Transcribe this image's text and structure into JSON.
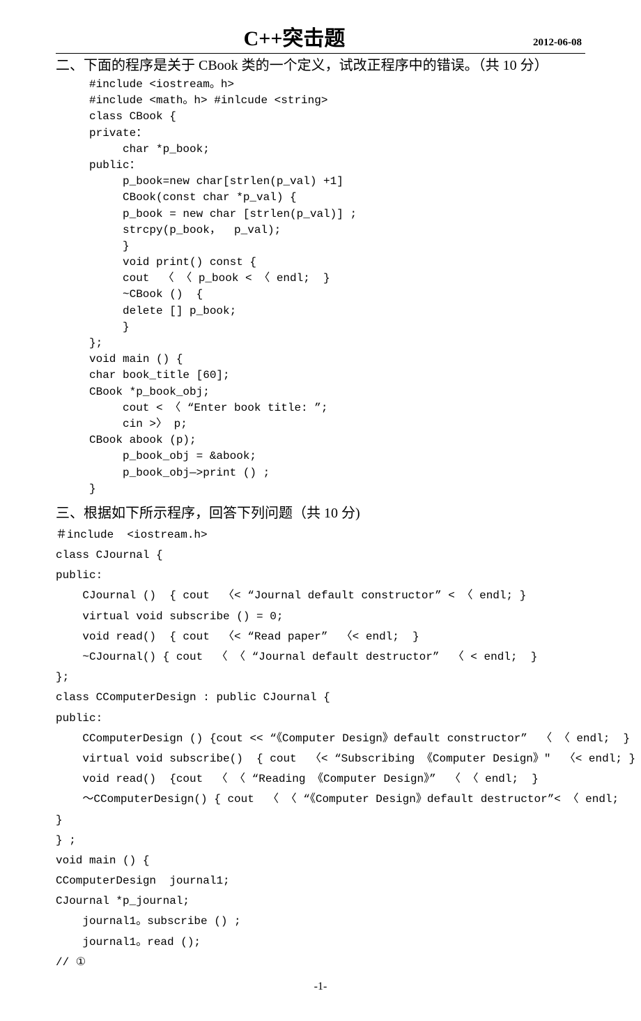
{
  "header": {
    "title": "C++突击题",
    "date": "2012-06-08"
  },
  "section2": {
    "heading": "二、下面的程序是关于 CBook 类的一个定义，试改正程序中的错误。（共 10 分）",
    "lines": {
      "l01": "#include <iostream。h>",
      "l02": "#include <math。h> #inlcude <string>",
      "l03": "class CBook {",
      "l04": "private：",
      "l05": "char *p_book;",
      "l06": "public：",
      "l07": "p_book=new char[strlen(p_val) +1]",
      "l08": "CBook(const char *p_val) {",
      "l09": "p_book = new char [strlen(p_val)] ;",
      "l10": "strcpy(p_book，  p_val);",
      "l11": "}",
      "l12": "void print() const {",
      "l13": "cout  〈 〈 p_book < 〈 endl;  }",
      "l14": "~CBook ()  {",
      "l15": "delete [] p_book;",
      "l16": "}",
      "l17": "};",
      "l18": "void main () {",
      "l19": "char book_title [60];",
      "l20": "CBook *p_book_obj;",
      "l21": "cout < 〈 “Enter book title: ”;",
      "l22": "cin >〉 p;",
      "l23": "CBook abook (p);",
      "l24": "p_book_obj = &abook;",
      "l25": "p_book_obj—>print () ;",
      "l26": "}"
    }
  },
  "section3": {
    "heading": "三、根据如下所示程序，回答下列问题（共 10 分)",
    "lines": {
      "l01": "＃include  <iostream.h>",
      "l02": "class CJournal {",
      "l03": "public:",
      "l04": "    CJournal ()  { cout  〈< “Journal default constructor” < 〈 endl; }",
      "l05": "    virtual void subscribe () = 0;",
      "l06": "    void read()  { cout  〈< “Read paper”  〈< endl;  }",
      "l07": "    ~CJournal() { cout  〈 〈 “Journal default destructor”  〈 < endl;  }",
      "l08": "};",
      "l09": "class CComputerDesign : public CJournal {",
      "l10": "public:",
      "l11": "    CComputerDesign () {cout << “《Computer Design》default constructor”  〈 〈 endl;  }",
      "l12": "    virtual void subscribe()  { cout  〈< “Subscribing 《Computer Design》\"  〈< endl; }",
      "l13": "    void read()  {cout  〈 〈 “Reading 《Computer Design》”  〈 〈 endl;  }",
      "l14": "    ～CComputerDesign() { cout  〈 〈 “《Computer Design》default destructor”< 〈 endl;",
      "l15": "}",
      "l16": "} ;",
      "l17": "void main () {",
      "l18": "CComputerDesign  journal1;",
      "l19": "CJournal *p_journal;",
      "l20": "    journal1。subscribe () ;",
      "l21": "    journal1。read ();",
      "l22": "// ①"
    }
  },
  "footer": "-1-"
}
